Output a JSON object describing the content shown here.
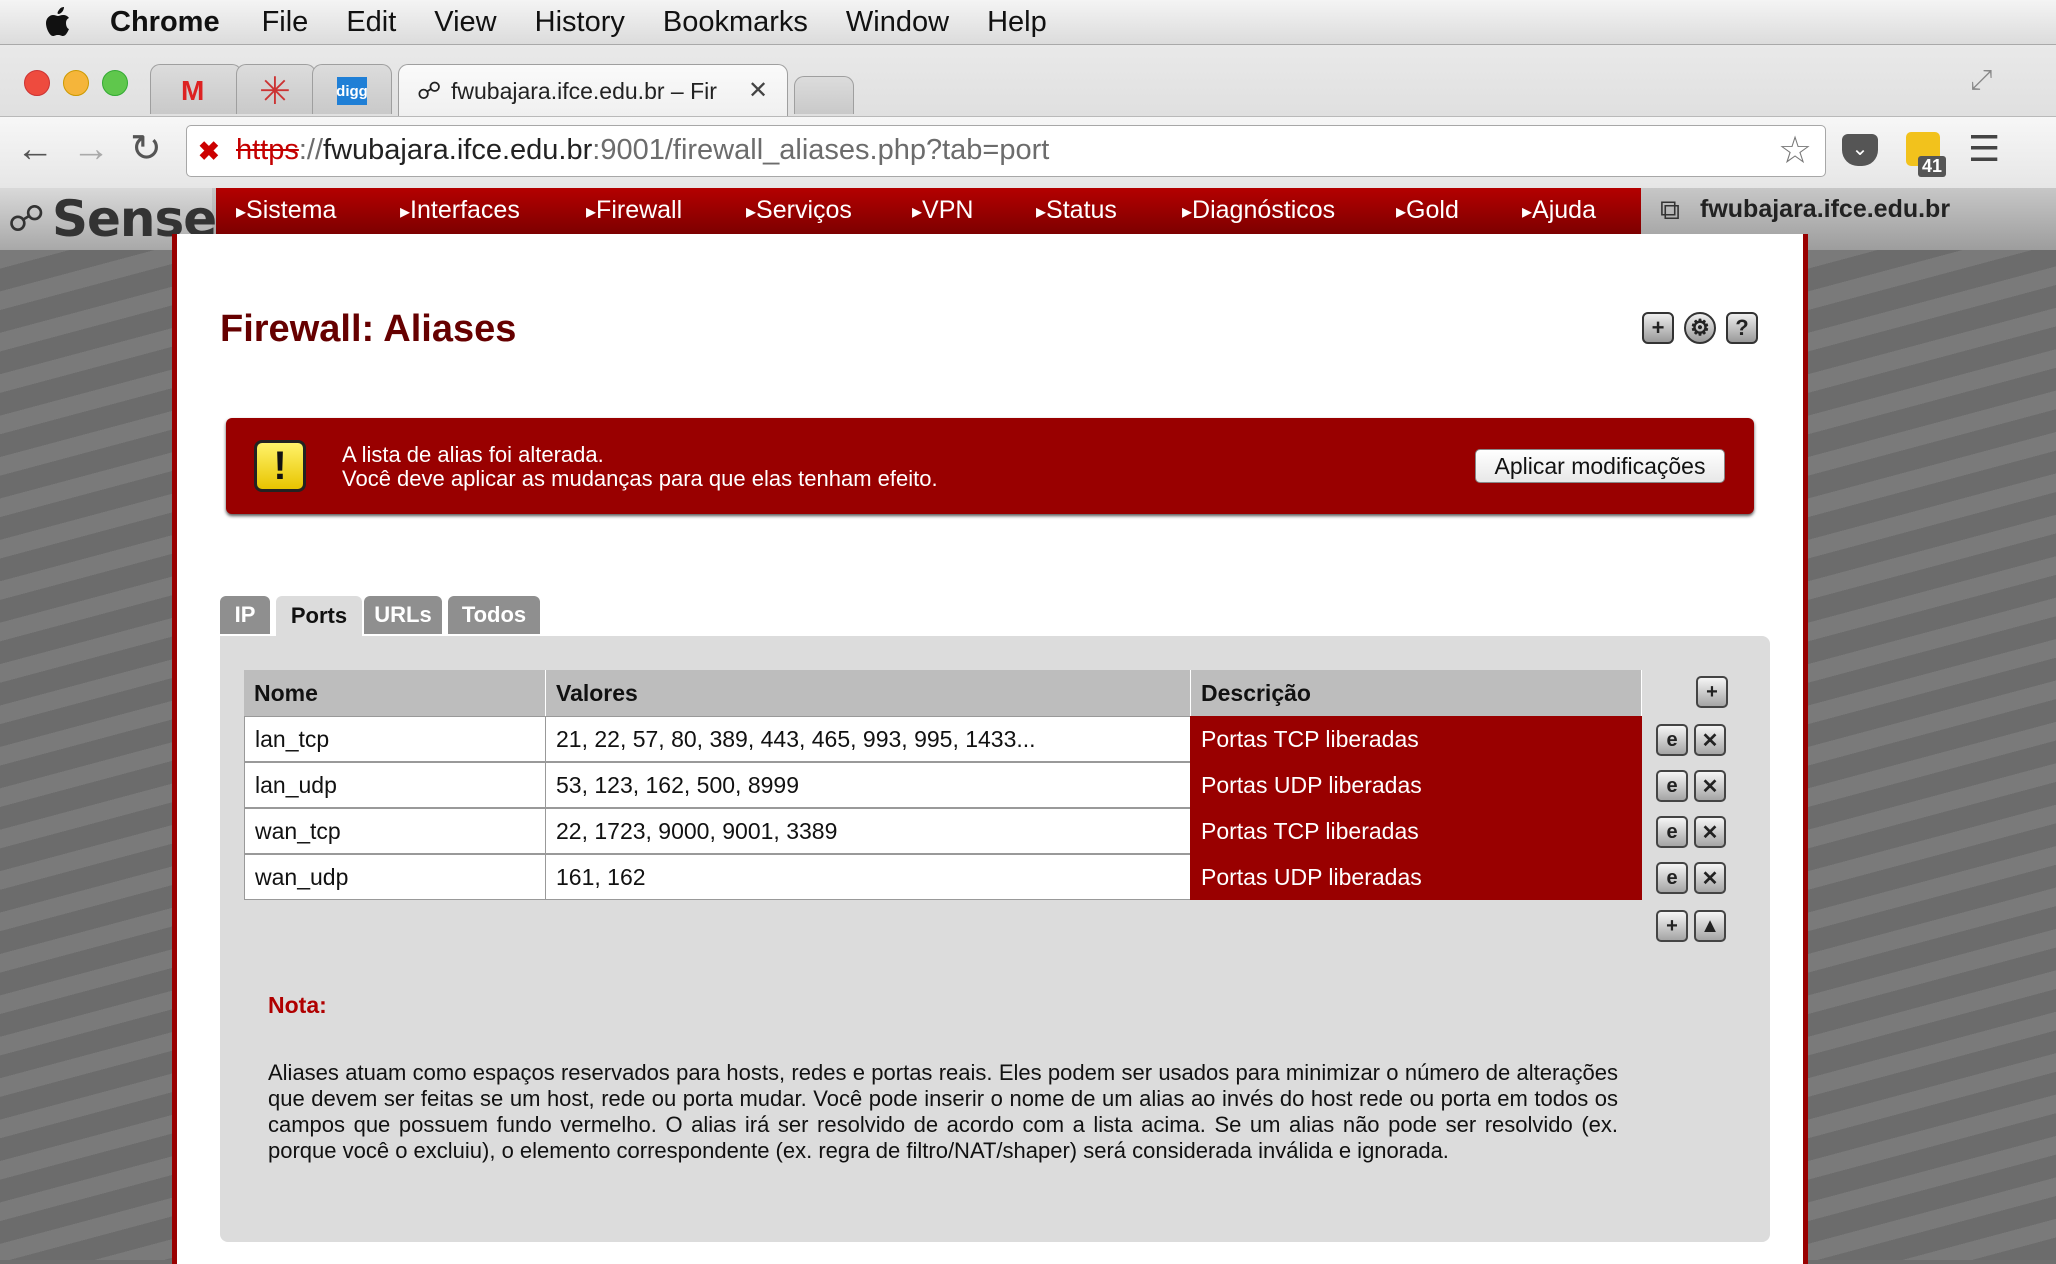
{
  "menubar": {
    "app": "Chrome",
    "items": [
      "File",
      "Edit",
      "View",
      "History",
      "Bookmarks",
      "Window",
      "Help"
    ]
  },
  "browser": {
    "active_tab_title": "fwubajara.ifce.edu.br – Fir",
    "favicon_tabs": [
      "gmail-icon",
      "asterisk-icon",
      "digg-icon"
    ],
    "digg_label": "digg",
    "url_scheme": "https",
    "url_sep": "://",
    "url_host": "fwubajara.ifce.edu.br",
    "url_rest": ":9001/firewall_aliases.php?tab=port",
    "extension_badge": "41"
  },
  "pfsense": {
    "logo": "Sense",
    "nav": [
      "Sistema",
      "Interfaces",
      "Firewall",
      "Serviços",
      "VPN",
      "Status",
      "Diagnósticos",
      "Gold",
      "Ajuda"
    ],
    "hostname": "fwubajara.ifce.edu.br"
  },
  "page": {
    "title": "Firewall: Aliases"
  },
  "alert": {
    "line1": "A lista de alias foi alterada.",
    "line2": "Você deve aplicar as mudanças para que elas tenham efeito.",
    "button": "Aplicar modificações"
  },
  "tabs": [
    {
      "label": "IP",
      "active": false
    },
    {
      "label": "Ports",
      "active": true
    },
    {
      "label": "URLs",
      "active": false
    },
    {
      "label": "Todos",
      "active": false
    }
  ],
  "table": {
    "headers": [
      "Nome",
      "Valores",
      "Descrição"
    ],
    "rows": [
      {
        "name": "lan_tcp",
        "values": "21, 22, 57, 80, 389, 443, 465, 993, 995, 1433...",
        "desc": "Portas TCP liberadas"
      },
      {
        "name": "lan_udp",
        "values": "53, 123, 162, 500, 8999",
        "desc": "Portas UDP liberadas"
      },
      {
        "name": "wan_tcp",
        "values": "22, 1723, 9000, 9001, 3389",
        "desc": "Portas TCP liberadas"
      },
      {
        "name": "wan_udp",
        "values": "161, 162",
        "desc": "Portas UDP liberadas"
      }
    ]
  },
  "note": {
    "label": "Nota:",
    "text": "Aliases atuam como espaços reservados para hosts, redes e portas reais. Eles podem ser usados para minimizar o número de alterações que devem ser feitas se um host, rede ou porta mudar. Você pode inserir o nome de um alias ao invés do host rede ou porta em todos os campos que possuem fundo vermelho. O alias irá ser resolvido de acordo com a lista acima. Se um alias não pode ser resolvido (ex. porque você o excluiu), o elemento correspondente (ex. regra de filtro/NAT/shaper) será considerada inválida e ignorada."
  },
  "colors": {
    "accent": "#990000",
    "title": "#660000",
    "nav": "#b40000"
  }
}
